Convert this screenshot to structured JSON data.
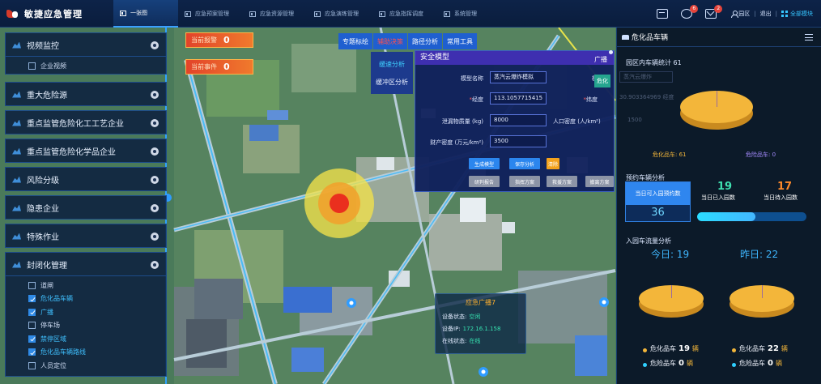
{
  "app": {
    "title": "敏捷应急管理",
    "nav": [
      {
        "label": "一张图",
        "active": true
      },
      {
        "label": "应急预案管理",
        "active": false
      },
      {
        "label": "应急资源管理",
        "active": false
      },
      {
        "label": "应急演练管理",
        "active": false
      },
      {
        "label": "应急指挥调度",
        "active": false
      },
      {
        "label": "系统管理",
        "active": false
      }
    ],
    "badges": {
      "messages": "6",
      "mail": "2"
    },
    "user": {
      "name": "园区",
      "sep": "|",
      "logout": "退出",
      "all_modules": "全部模块"
    }
  },
  "left_panel": {
    "sections": [
      {
        "title": "视频监控"
      },
      {
        "title": "重大危险源"
      },
      {
        "title": "重点监管危险化工工艺企业"
      },
      {
        "title": "重点监管危险化学品企业"
      },
      {
        "title": "风险分级"
      },
      {
        "title": "隐患企业"
      },
      {
        "title": "特殊作业"
      },
      {
        "title": "封闭化管理"
      }
    ],
    "video_items": [
      {
        "label": "企业视频",
        "checked": false
      }
    ],
    "closed_items": [
      {
        "label": "道闸",
        "checked": false
      },
      {
        "label": "危化品车辆",
        "checked": true
      },
      {
        "label": "广播",
        "checked": true
      },
      {
        "label": "停车场",
        "checked": false
      },
      {
        "label": "禁停区域",
        "checked": true
      },
      {
        "label": "危化品车辆路线",
        "checked": true
      },
      {
        "label": "人员定位",
        "checked": false
      }
    ]
  },
  "alerts": {
    "warning_label": "当前报警",
    "warning_value": "0",
    "event_label": "当前事件",
    "event_value": "0"
  },
  "map_tools": {
    "buttons": [
      {
        "label": "专题标绘",
        "active": false
      },
      {
        "label": "辅助决策",
        "active": true
      },
      {
        "label": "路径分析",
        "active": false
      },
      {
        "label": "常用工具",
        "active": false
      }
    ],
    "submenu": [
      {
        "label": "缓速分析",
        "active": true
      },
      {
        "label": "缓冲区分析",
        "active": false
      }
    ]
  },
  "dialog": {
    "title": "安全模型",
    "model_label": "模型名称",
    "model_value": "蒸汽云爆炸模拟",
    "lng_label": "经度",
    "lng_value": "113.1057715415",
    "lat_label": "纬度",
    "mass_label": "泄漏物质量 (kg)",
    "mass_value": "8000",
    "pop_label": "人口密度 (人/km²)",
    "prop_label": "财产密度 (万元/km²)",
    "prop_value": "3500",
    "btn_generate": "生成模型",
    "btn_save": "保存分析",
    "btn_orange": "清除",
    "grey_buttons": [
      "研判报告",
      "指挥方案",
      "救援方案",
      "撤离方案"
    ],
    "side_label": "模"
  },
  "broadcast_side": {
    "label": "广播",
    "toggle": "危化"
  },
  "device_popup": {
    "title": "应急广播7",
    "status_label": "设备状态:",
    "status_value": "空闲",
    "ip_label": "设备IP:",
    "ip_value": "172.16.1.158",
    "online_label": "在线状态:",
    "online_value": "在线"
  },
  "right_panel": {
    "title": "危化品车辆",
    "in_park_label": "园区内车辆统计",
    "in_park_value": "61",
    "ghost_select": "蒸汽云爆炸",
    "ghost_coord": "30.903364969",
    "ghost_coord_unit": "经度",
    "ghost_value": "1500",
    "pie1_legend_a": "危化品车:",
    "pie1_legend_a_value": "61",
    "pie1_legend_b": "危险品车:",
    "pie1_legend_b_value": "0",
    "booking_label": "预约车辆分析",
    "booked_label": "当日可入园预约数",
    "booked_value": "36",
    "entered_label": "当日已入园数",
    "entered_value": "19",
    "pending_label": "当日待入园数",
    "pending_value": "17",
    "progress": 0.53,
    "flow_label": "入园车流量分析",
    "today_label": "今日:",
    "today_value": "19",
    "yesterday_label": "昨日:",
    "yesterday_value": "22",
    "today_legend": [
      {
        "label": "危化品车",
        "value": "19",
        "unit": "辆",
        "color": "#f3b63a"
      },
      {
        "label": "危险品车",
        "value": "0",
        "unit": "辆",
        "color": "#2fd0ff"
      }
    ],
    "yesterday_legend": [
      {
        "label": "危化品车",
        "value": "22",
        "unit": "辆",
        "color": "#f3b63a"
      },
      {
        "label": "危险品车",
        "value": "0",
        "unit": "辆",
        "color": "#2fd0ff"
      }
    ]
  },
  "colors": {
    "accent": "#2f86ef",
    "alert": "#e2432a",
    "pie": "#f3b63a",
    "dialog_header": "#3e2fb0"
  }
}
